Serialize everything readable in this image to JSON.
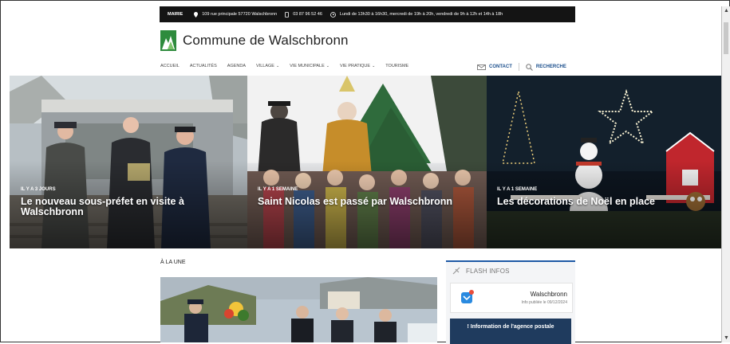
{
  "infobar": {
    "mairie_label": "MAIRIE",
    "address": "109 rue principale 57720 Walschbronn",
    "phone": "03 87 96 52 46",
    "hours": "Lundi de 13h30 à 16h30, mercredi de 19h à 20h, vendredi de 9h à 12h et 14h à 18h"
  },
  "site": {
    "title": "Commune de Walschbronn",
    "brand_color": "#2e8b3d",
    "accent_color": "#1f5aa6"
  },
  "nav": {
    "items": [
      {
        "label": "ACCUEIL",
        "dropdown": false
      },
      {
        "label": "ACTUALITÉS",
        "dropdown": false
      },
      {
        "label": "AGENDA",
        "dropdown": false
      },
      {
        "label": "VILLAGE",
        "dropdown": true
      },
      {
        "label": "VIE MUNICIPALE",
        "dropdown": true
      },
      {
        "label": "VIE PRATIQUE",
        "dropdown": true
      },
      {
        "label": "TOURISME",
        "dropdown": false
      }
    ],
    "contact_label": "CONTACT",
    "search_label": "RECHERCHE",
    "caret": "⌄"
  },
  "hero": {
    "slides": [
      {
        "meta": "IL Y A 3 JOURS",
        "headline": "Le nouveau sous-préfet en visite à Walschbronn"
      },
      {
        "meta": "IL Y A 1 SEMAINE",
        "headline": "Saint Nicolas est passé par Walschbronn"
      },
      {
        "meta": "IL Y A 1 SEMAINE",
        "headline": "Les décorations de Noël en place"
      }
    ]
  },
  "une": {
    "title": "À LA UNE"
  },
  "flash": {
    "title": "FLASH INFOS",
    "card_title": "Walschbronn",
    "card_date": "Info publiée le 09/12/2024",
    "message": "! Information de l'agence postale"
  }
}
